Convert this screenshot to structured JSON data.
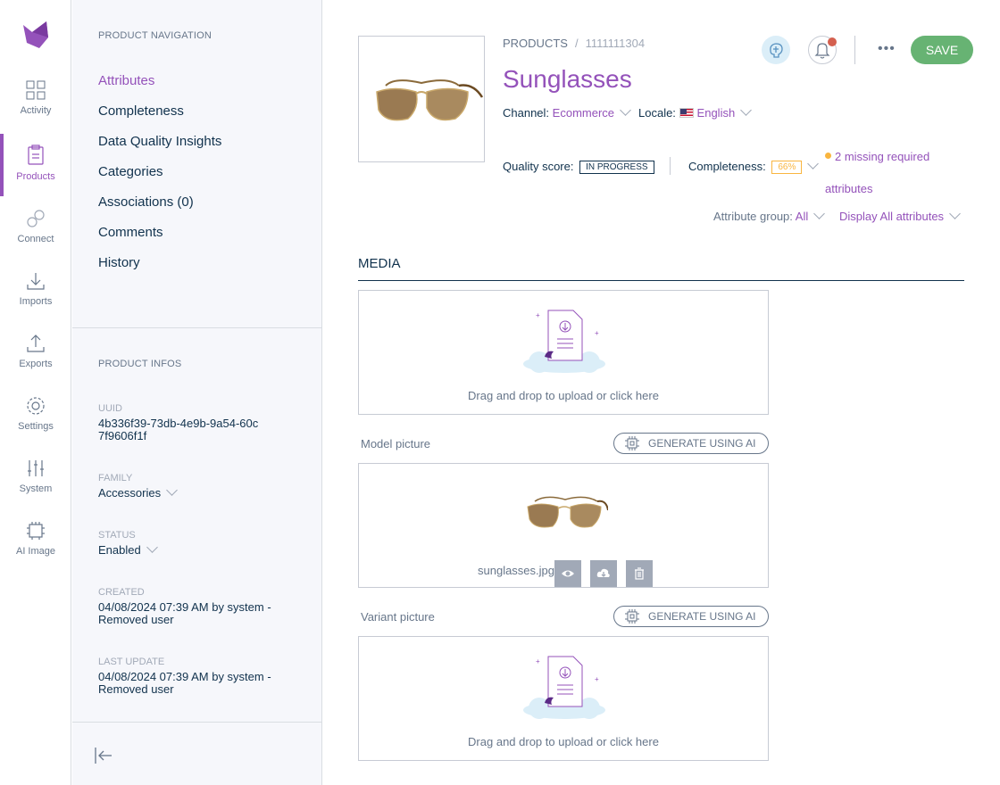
{
  "nav": {
    "items": [
      {
        "label": "Activity",
        "icon": "activity-icon"
      },
      {
        "label": "Products",
        "icon": "products-icon",
        "active": true
      },
      {
        "label": "Connect",
        "icon": "connect-icon"
      },
      {
        "label": "Imports",
        "icon": "imports-icon"
      },
      {
        "label": "Exports",
        "icon": "exports-icon"
      },
      {
        "label": "Settings",
        "icon": "settings-icon"
      },
      {
        "label": "System",
        "icon": "system-icon"
      },
      {
        "label": "AI Image",
        "icon": "ai-image-icon"
      }
    ],
    "accent": "#9452ba"
  },
  "product_navigation": {
    "title": "PRODUCT NAVIGATION",
    "links": [
      "Attributes",
      "Completeness",
      "Data Quality Insights",
      "Categories",
      "Associations (0)",
      "Comments",
      "History"
    ]
  },
  "product_infos": {
    "title": "PRODUCT INFOS",
    "uuid_label": "UUID",
    "uuid": "4b336f39-73db-4e9b-9a54-60c7f9606f1f",
    "family_label": "FAMILY",
    "family": "Accessories",
    "status_label": "STATUS",
    "status": "Enabled",
    "created_label": "CREATED",
    "created": "04/08/2024 07:39 AM by system - Removed user",
    "last_update_label": "LAST UPDATE",
    "last_update": "04/08/2024 07:39 AM by system - Removed user"
  },
  "header": {
    "breadcrumb_root": "PRODUCTS",
    "breadcrumb_sep": "/",
    "breadcrumb_id": "1111111304",
    "title": "Sunglasses",
    "channel_label": "Channel:",
    "channel": "Ecommerce",
    "locale_label": "Locale:",
    "locale": "English",
    "quality_label": "Quality score:",
    "quality_badge": "IN PROGRESS",
    "completeness_label": "Completeness:",
    "completeness_value": "66%",
    "missing_text": "2 missing required attributes",
    "attr_group_label": "Attribute group:",
    "attr_group_value": "All",
    "display_all": "Display All attributes",
    "save_label": "SAVE",
    "more_label": "•••",
    "save_color": "#67b373"
  },
  "media": {
    "section_title": "MEDIA",
    "dropzone_text": "Drag and drop to upload or click here",
    "model_label": "Model picture",
    "variant_label": "Variant picture",
    "ai_button_label": "GENERATE USING AI",
    "file_name": "sunglasses.jpg"
  }
}
